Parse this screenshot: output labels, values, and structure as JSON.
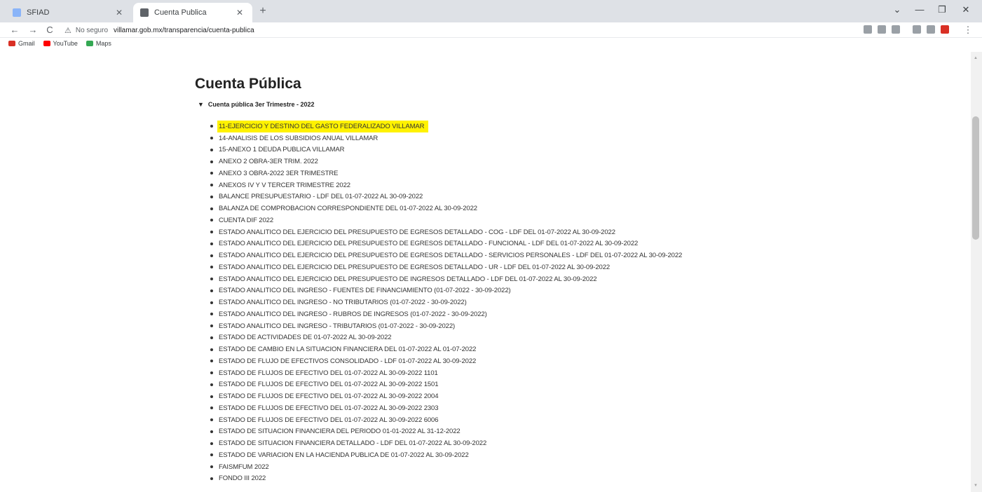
{
  "browser": {
    "tabs": [
      {
        "title": "SFIAD",
        "active": false
      },
      {
        "title": "Cuenta Publica",
        "active": true
      }
    ],
    "new_tab_glyph": "+",
    "window_controls": [
      "⌄",
      "—",
      "❐",
      "✕"
    ],
    "nav": {
      "back": "←",
      "forward": "→",
      "reload": "C"
    },
    "address": {
      "security_label": "No seguro",
      "url": "villamar.gob.mx/transparencia/cuenta-publica"
    },
    "bookmarks": [
      {
        "label": "Gmail",
        "icon": "gmail-icon",
        "color": "#d93025"
      },
      {
        "label": "YouTube",
        "icon": "youtube-icon",
        "color": "#ff0000"
      },
      {
        "label": "Maps",
        "icon": "maps-icon",
        "color": "#34a853"
      }
    ]
  },
  "page": {
    "title": "Cuenta Pública",
    "section": {
      "toggle_glyph": "▼",
      "label": "Cuenta pública 3er Trimestre - 2022"
    },
    "documents": [
      "11-EJERCICIO Y DESTINO DEL GASTO FEDERALIZADO VILLAMAR",
      "14-ANALISIS DE LOS SUBSIDIOS ANUAL VILLAMAR",
      "15-ANEXO 1 DEUDA PUBLICA VILLAMAR",
      "ANEXO 2 OBRA-3ER TRIM. 2022",
      "ANEXO 3 OBRA-2022 3ER TRIMESTRE",
      "ANEXOS IV Y V TERCER TRIMESTRE 2022",
      "BALANCE PRESUPUESTARIO - LDF DEL 01-07-2022 AL 30-09-2022",
      "BALANZA DE COMPROBACION CORRESPONDIENTE DEL 01-07-2022 AL 30-09-2022",
      "CUENTA DIF 2022",
      "ESTADO ANALITICO DEL EJERCICIO DEL PRESUPUESTO DE EGRESOS DETALLADO - COG - LDF DEL 01-07-2022 AL 30-09-2022",
      "ESTADO ANALITICO DEL EJERCICIO DEL PRESUPUESTO DE EGRESOS DETALLADO - FUNCIONAL - LDF DEL 01-07-2022 AL 30-09-2022",
      "ESTADO ANALITICO DEL EJERCICIO DEL PRESUPUESTO DE EGRESOS DETALLADO - SERVICIOS PERSONALES - LDF DEL 01-07-2022 AL 30-09-2022",
      "ESTADO ANALITICO DEL EJERCICIO DEL PRESUPUESTO DE EGRESOS DETALLADO - UR - LDF DEL 01-07-2022 AL 30-09-2022",
      "ESTADO ANALITICO DEL EJERCICIO DEL PRESUPUESTO DE INGRESOS DETALLADO - LDF DEL 01-07-2022 AL 30-09-2022",
      "ESTADO ANALITICO DEL INGRESO - FUENTES DE FINANCIAMIENTO (01-07-2022 - 30-09-2022)",
      "ESTADO ANALITICO DEL INGRESO - NO TRIBUTARIOS (01-07-2022 - 30-09-2022)",
      "ESTADO ANALITICO DEL INGRESO - RUBROS DE INGRESOS (01-07-2022 - 30-09-2022)",
      "ESTADO ANALITICO DEL INGRESO - TRIBUTARIOS (01-07-2022 - 30-09-2022)",
      "ESTADO DE ACTIVIDADES DE 01-07-2022 AL 30-09-2022",
      "ESTADO DE CAMBIO EN LA SITUACION FINANCIERA DEL 01-07-2022 AL 01-07-2022",
      "ESTADO DE FLUJO DE EFECTIVOS CONSOLIDADO - LDF 01-07-2022 AL 30-09-2022",
      "ESTADO DE FLUJOS DE EFECTIVO DEL 01-07-2022 AL 30-09-2022 1101",
      "ESTADO DE FLUJOS DE EFECTIVO DEL 01-07-2022 AL 30-09-2022 1501",
      "ESTADO DE FLUJOS DE EFECTIVO DEL 01-07-2022 AL 30-09-2022 2004",
      "ESTADO DE FLUJOS DE EFECTIVO DEL 01-07-2022 AL 30-09-2022 2303",
      "ESTADO DE FLUJOS DE EFECTIVO DEL 01-07-2022 AL 30-09-2022 6006",
      "ESTADO DE SITUACION FINANCIERA DEL PERIODO 01-01-2022 AL 31-12-2022",
      "ESTADO DE SITUACION FINANCIERA DETALLADO - LDF DEL 01-07-2022 AL 30-09-2022",
      "ESTADO DE VARIACION EN LA HACIENDA PUBLICA DE 01-07-2022 AL 30-09-2022",
      "FAISMFUM 2022",
      "FONDO III 2022"
    ],
    "highlighted_index": 0,
    "highlight_color": "#fff200"
  }
}
